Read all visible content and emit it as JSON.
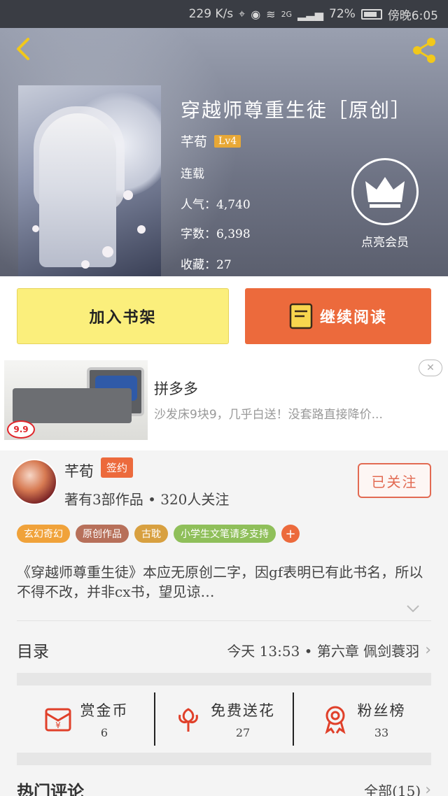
{
  "status_bar": {
    "speed": "229 K/s",
    "network": "2G",
    "battery": "72%",
    "time": "傍晚6:05"
  },
  "header": {
    "back_icon": "chevron-left-icon",
    "share_icon": "share-icon",
    "title": "穿越师尊重生徒［原创］",
    "author": "芊荀",
    "level": "Lv4",
    "status": "连载",
    "popularity": "人气：4,740",
    "word_count": "字数：6,398",
    "favorites": "收藏：27",
    "vip_label": "点亮会员"
  },
  "actions": {
    "add_to_shelf": "加入书架",
    "continue_reading": "继续阅读"
  },
  "ad": {
    "title": "拼多多",
    "description": "沙发床9块9，几乎白送！没套路直接降价...",
    "price_badge": "9.9",
    "close_icon": "close-icon"
  },
  "author_panel": {
    "name": "芊荀",
    "signed_badge": "签约",
    "stats": "著有3部作品 • 320人关注",
    "follow_button": "已关注"
  },
  "tags": [
    {
      "label": "玄幻奇幻",
      "color": "#f0a23a"
    },
    {
      "label": "原创作品",
      "color": "#b7705a"
    },
    {
      "label": "古耽",
      "color": "#d8a040"
    },
    {
      "label": "小学生文笔请多支持",
      "color": "#8fbf5a"
    }
  ],
  "tag_more": "+",
  "synopsis": "《穿越师尊重生徒》本应无原创二字，因gf表明已有此书名，所以不得不改，并非cx书，望见谅…",
  "toc": {
    "label": "目录",
    "latest": "今天 13:53  •  第六章 佩剑蓑羽"
  },
  "stats": [
    {
      "label": "赏金币",
      "value": "6",
      "icon": "coin-envelope-icon"
    },
    {
      "label": "免费送花",
      "value": "27",
      "icon": "flower-icon"
    },
    {
      "label": "粉丝榜",
      "value": "33",
      "icon": "medal-icon"
    }
  ],
  "comments": {
    "title": "热门评论",
    "all": "全部(15)"
  },
  "colors": {
    "accent": "#ec6a3c",
    "shelf_button": "#fbef7c",
    "follow": "#e26a52"
  }
}
